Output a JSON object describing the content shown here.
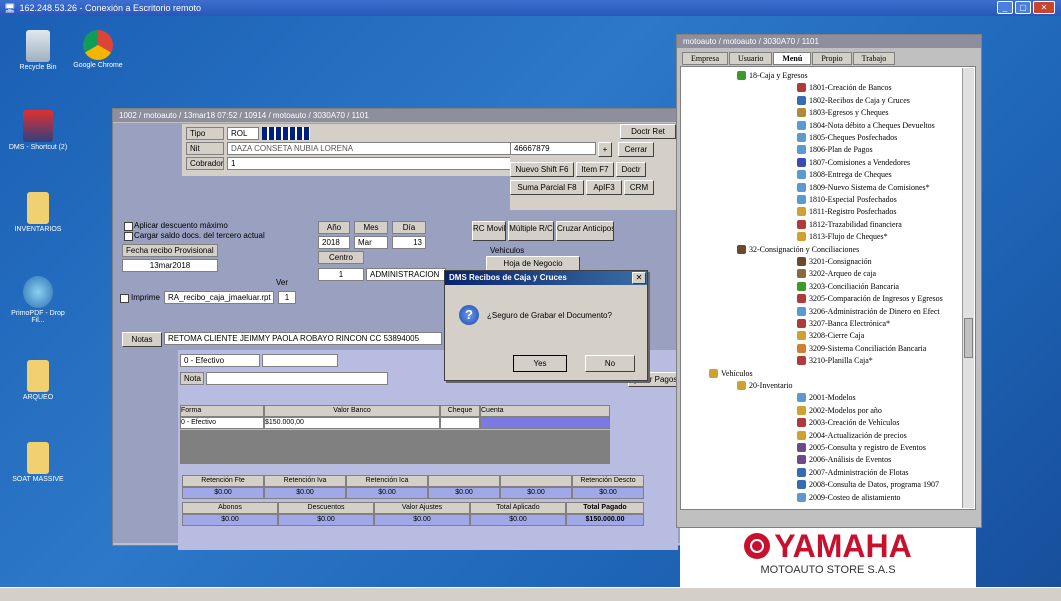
{
  "rdp": {
    "title": "162.248.53.26 - Conexión a Escritorio remoto"
  },
  "desktop": {
    "icons": [
      {
        "label": "Recycle Bin"
      },
      {
        "label": "Google Chrome"
      },
      {
        "label": "DMS - Shortcut (2)"
      },
      {
        "label": "INVENTARIOS"
      },
      {
        "label": "PrimoPDF - Drop Fil..."
      },
      {
        "label": "ARQUEO"
      },
      {
        "label": "SOAT MASSIVE"
      }
    ]
  },
  "main": {
    "title": "1002 / motoauto / 13mar18 07:52 / 10914 / motoauto / 3030A70 / 1101",
    "tipo_label": "Tipo",
    "tipo_value": "ROL",
    "nit_label": "Nit",
    "nit_value": "DAZA CONSETA NUBIA LORENA",
    "cobrador_label": "Cobrador",
    "cobrador_value": "1",
    "phone_value": "46667879",
    "cerrar": "Cerrar",
    "btn_nuevo": "Nuevo Shift F6",
    "btn_item": "Item F7",
    "btn_doctor": "Doctr",
    "btn_suma": "Suma Parcial F8",
    "btn_apl": "ApIF3",
    "btn_crm": "CRM",
    "btn_doctor_ret": "Doctr Ret",
    "chk_aplicar": "Aplicar descuento máximo",
    "chk_cargar": "Cargar saldo docs. del tercero actual",
    "fecha_label": "Fecha recibo Provisional",
    "fecha_value": "13mar2018",
    "ano_label": "Año",
    "mes_label": "Mes",
    "dia_label": "Día",
    "ano_value": "2018",
    "mes_value": "Mar",
    "dia_value": "13",
    "centro_label": "Centro",
    "centro_value": "1",
    "centro_name": "ADMINISTRACION",
    "btn_rcmovil": "RC Movil",
    "btn_multiple": "Múltiple R/C",
    "btn_cruzar": "Cruzar Anticipos",
    "vehiculos": "Vehiculos",
    "btn_hoja": "Hoja de Negocio",
    "ver": "Ver",
    "imprime": "Imprime",
    "formato": "RA_recibo_caja_jmaeluar.rpt",
    "copias": "1",
    "notas_label": "Notas",
    "notas_value": "RETOMA CLIENTE JEIMMY PAOLA ROBAYO RINCON CC 53894005",
    "forma_value": "0 - Efectivo",
    "nota_label": "Nota",
    "btn_pagos": "Quitar Pagos",
    "grid_headers": [
      "Forma",
      "Valor Banco",
      "Cheque",
      "Cuenta"
    ],
    "grid_row": [
      "0 - Efectivo",
      "$150.000,00",
      "",
      ""
    ],
    "sum1_headers": [
      "Retención Fte",
      "Retención Iva",
      "Retención Ica",
      "",
      "",
      "Retención Descto"
    ],
    "sum1_values": [
      "$0.00",
      "$0.00",
      "$0.00",
      "$0.00",
      "$0.00",
      "$0.00"
    ],
    "sum2_headers": [
      "Abonos",
      "Descuentos",
      "Valor Ajustes",
      "Total Aplicado",
      "Total Pagado"
    ],
    "sum2_values": [
      "$0.00",
      "$0.00",
      "$0.00",
      "$0.00",
      "$150.000.00"
    ]
  },
  "dialog": {
    "title": "DMS Recibos de Caja y Cruces",
    "message": "¿Seguro de Grabar el Documento?",
    "yes": "Yes",
    "no": "No"
  },
  "menu": {
    "title": "motoauto / motoauto / 3030A70 / 1101",
    "tabs": [
      "Empresa",
      "Usuario",
      "Menú",
      "Propio",
      "Trabajo"
    ],
    "nodes": [
      {
        "text": "18-Caja y Egresos",
        "level": 1,
        "color": "#3a9a2a"
      },
      {
        "text": "1801-Creación de Bancos",
        "level": 2,
        "color": "#b03a3a"
      },
      {
        "text": "1802-Recibos de Caja y Cruces",
        "level": 2,
        "color": "#3a6ab0"
      },
      {
        "text": "1803-Egresos y Cheques",
        "level": 2,
        "color": "#b08a3a"
      },
      {
        "text": "1804-Nota débito a Cheques Devueltos",
        "level": 2,
        "color": "#5a9ad0"
      },
      {
        "text": "1805-Cheques Posfechados",
        "level": 2,
        "color": "#5a9ad0"
      },
      {
        "text": "1806-Plan de Pagos",
        "level": 2,
        "color": "#5a9ad0"
      },
      {
        "text": "1807-Comisiones a Vendedores",
        "level": 2,
        "color": "#3a4ab0"
      },
      {
        "text": "1808-Entrega de Cheques",
        "level": 2,
        "color": "#5a9ad0"
      },
      {
        "text": "1809-Nuevo Sistema de Comisiones*",
        "level": 2,
        "color": "#5a9ad0"
      },
      {
        "text": "1810-Especial Posfechados",
        "level": 2,
        "color": "#5a9ad0"
      },
      {
        "text": "1811-Registro Posfechados",
        "level": 2,
        "color": "#d0a030"
      },
      {
        "text": "1812-Trazabilidad financiera",
        "level": 2,
        "color": "#b03a3a"
      },
      {
        "text": "1813-Flujo de Cheques*",
        "level": 2,
        "color": "#d0a030"
      },
      {
        "text": "32-Consignación y Conciliaciones",
        "level": 1,
        "color": "#6a4a2a"
      },
      {
        "text": "3201-Consignación",
        "level": 2,
        "color": "#6a4a2a"
      },
      {
        "text": "3202-Arqueo de caja",
        "level": 2,
        "color": "#8a6a3a"
      },
      {
        "text": "3203-Conciliación Bancaria",
        "level": 2,
        "color": "#3a9a2a"
      },
      {
        "text": "3205-Comparación de Ingresos y Egresos",
        "level": 2,
        "color": "#b03a3a"
      },
      {
        "text": "3206-Administración de Dinero en Efect",
        "level": 2,
        "color": "#5a9ad0"
      },
      {
        "text": "3207-Banca Electrónica*",
        "level": 2,
        "color": "#b03a3a"
      },
      {
        "text": "3208-Cierre Caja",
        "level": 2,
        "color": "#d0a030"
      },
      {
        "text": "3209-Sistema Conciliación Bancaria",
        "level": 2,
        "color": "#d08030"
      },
      {
        "text": "3210-Planilla Caja*",
        "level": 2,
        "color": "#b03a3a"
      },
      {
        "text": "Vehículos",
        "level": 0,
        "color": "#d0a030"
      },
      {
        "text": "20-Inventario",
        "level": 1,
        "color": "#d0a030"
      },
      {
        "text": "2001-Modelos",
        "level": 2,
        "color": "#5a9ad0"
      },
      {
        "text": "2002-Modelos por año",
        "level": 2,
        "color": "#d0a030"
      },
      {
        "text": "2003-Creación de Vehículos",
        "level": 2,
        "color": "#b03a3a"
      },
      {
        "text": "2004-Actualización de precios",
        "level": 2,
        "color": "#d0a030"
      },
      {
        "text": "2005-Consulta y registro de Eventos",
        "level": 2,
        "color": "#6a4a8a"
      },
      {
        "text": "2006-Análisis de Eventos",
        "level": 2,
        "color": "#6a4a8a"
      },
      {
        "text": "2007-Administración de Flotas",
        "level": 2,
        "color": "#3a6ab0"
      },
      {
        "text": "2008-Consulta de Datos, programa 1907",
        "level": 2,
        "color": "#3a6ab0"
      },
      {
        "text": "2009-Costeo de alistamiento",
        "level": 2,
        "color": "#5a9ad0"
      }
    ]
  },
  "brand": {
    "name": "YAMAHA",
    "store": "MOTOAUTO STORE S.A.S",
    "color": "#c8102e"
  }
}
